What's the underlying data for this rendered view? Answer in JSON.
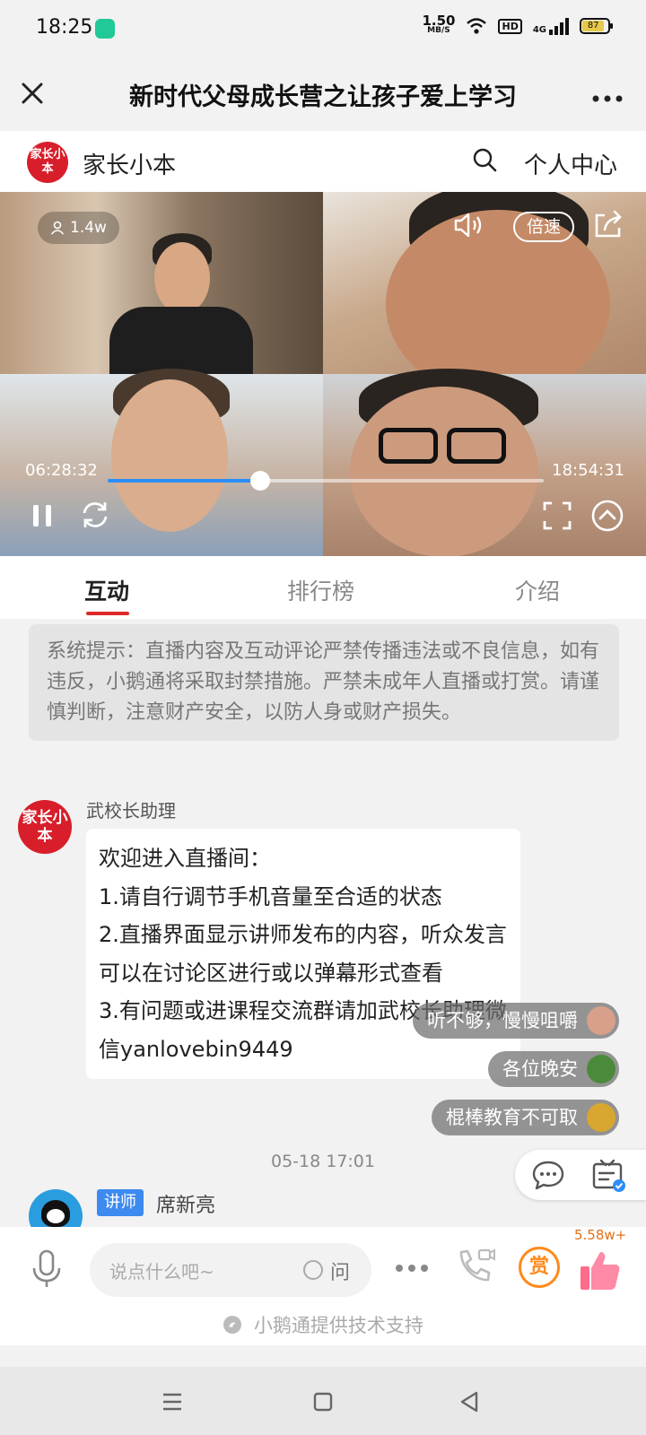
{
  "status_bar": {
    "time": "18:25",
    "net_speed": "1.50",
    "net_unit": "MB/S",
    "hd": "HD",
    "network": "4G",
    "battery": "87"
  },
  "title_bar": {
    "title": "新时代父母成长营之让孩子爱上学习"
  },
  "channel": {
    "logo_text": "家长小本",
    "name": "家长小本",
    "personal_center": "个人中心"
  },
  "player": {
    "viewers": "1.4w",
    "speed_label": "倍速",
    "current_time": "06:28:32",
    "total_time": "18:54:31",
    "progress": 0.35
  },
  "tabs": [
    "互动",
    "排行榜",
    "介绍"
  ],
  "chat": {
    "system_notice": "系统提示：直播内容及互动评论严禁传播违法或不良信息，如有违反，小鹅通将采取封禁措施。严禁未成年人直播或打赏。请谨慎判断，注意财产安全，以防人身或财产损失。",
    "message": {
      "sender": "武校长助理",
      "avatar_text": "家长小本",
      "lines": [
        "欢迎进入直播间：",
        "1.请自行调节手机音量至合适的状态",
        "2.直播界面显示讲师发布的内容，听众发言可以在讨论区进行或以弹幕形式查看",
        "3.有问题或进课程交流群请加武校长助理微信yanlovebin9449"
      ]
    },
    "timestamp": "05-18 17:01",
    "lecturer": {
      "badge": "讲师",
      "name": "席新亮"
    }
  },
  "danmaku": [
    {
      "text": "听不够，慢慢咀嚼",
      "color": "#d8a08a"
    },
    {
      "text": "各位晚安",
      "color": "#4a8a3a"
    },
    {
      "text": "棍棒教育不可取",
      "color": "#d9a630"
    }
  ],
  "bottom_bar": {
    "input_placeholder": "说点什么吧~",
    "ask_label": "问",
    "reward_label": "赏",
    "likes": "5.58w+",
    "powered_by": "小鹅通提供技术支持"
  },
  "colors": {
    "accent_red": "#d81e2a",
    "progress_blue": "#2c8ef8",
    "reward_orange": "#ff8a1c"
  }
}
